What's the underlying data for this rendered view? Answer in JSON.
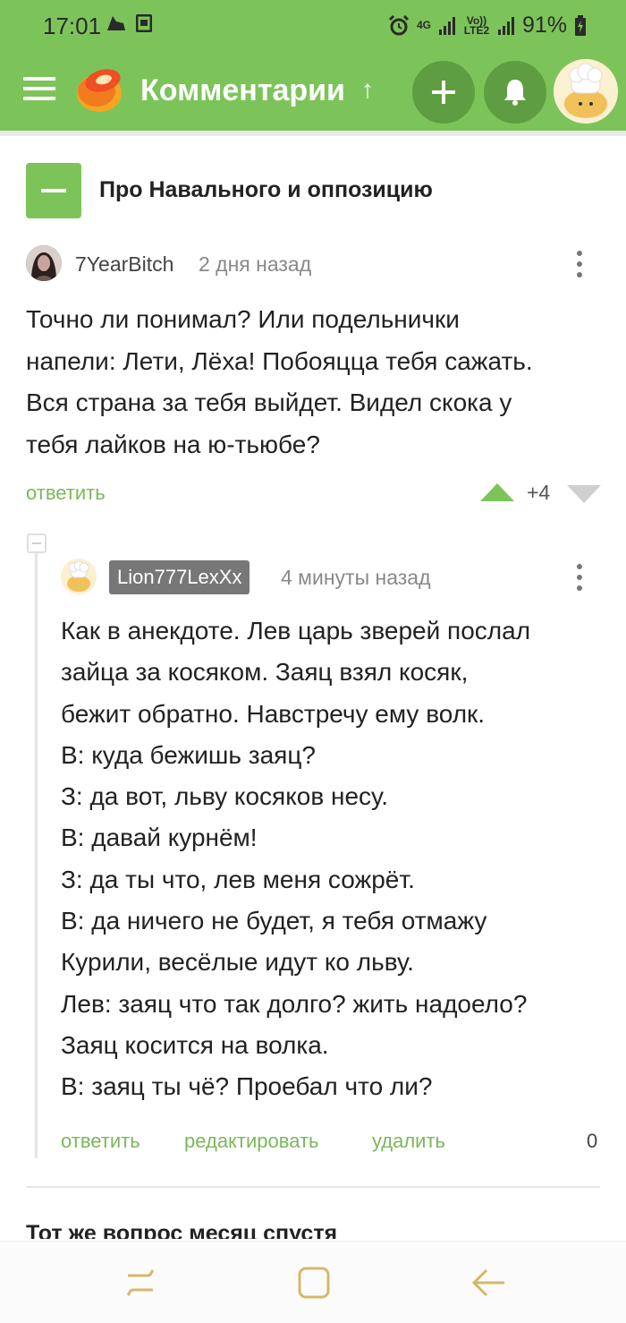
{
  "status_bar": {
    "time": "17:01",
    "network_4g": "4G",
    "volte": "Vo)) LTE2",
    "battery": "91%"
  },
  "app_bar": {
    "title": "Комментарии",
    "accent_color": "#7cc45a"
  },
  "story": {
    "title": "Про Навального и оппозицию"
  },
  "comment1": {
    "username": "7YearBitch",
    "time": "2 дня назад",
    "lines": [
      "Точно ли понимал? Или подельнички",
      "напели: Лети, Лёха! Побояцца тебя сажать.",
      "Вся страна за тебя выйдет. Видел скока у",
      "тебя лайков на ю-тьюбе?"
    ],
    "reply_label": "ответить",
    "rating": "+4"
  },
  "comment2": {
    "username": "Lion777LexXx",
    "time": "4 минуты назад",
    "lines": [
      "Как в анекдоте. Лев царь зверей послал",
      "зайца за косяком. Заяц взял косяк,",
      "бежит обратно. Навстречу ему волк.",
      "В: куда бежишь заяц?",
      "З: да вот, льву косяков несу.",
      "В: давай курнём!",
      "З: да ты что, лев меня сожрёт.",
      "В: да ничего не будет, я тебя отмажу",
      "Курили, весёлые идут ко льву.",
      "Лев: заяц что так долго? жить надоело?",
      "Заяц косится на волка.",
      "В: заяц ты чё? Проебал что ли?"
    ],
    "actions": {
      "reply": "ответить",
      "edit": "редактировать",
      "delete": "удалить"
    },
    "rating": "0"
  },
  "next_story": {
    "title": "Тот же вопрос месяц спустя"
  }
}
